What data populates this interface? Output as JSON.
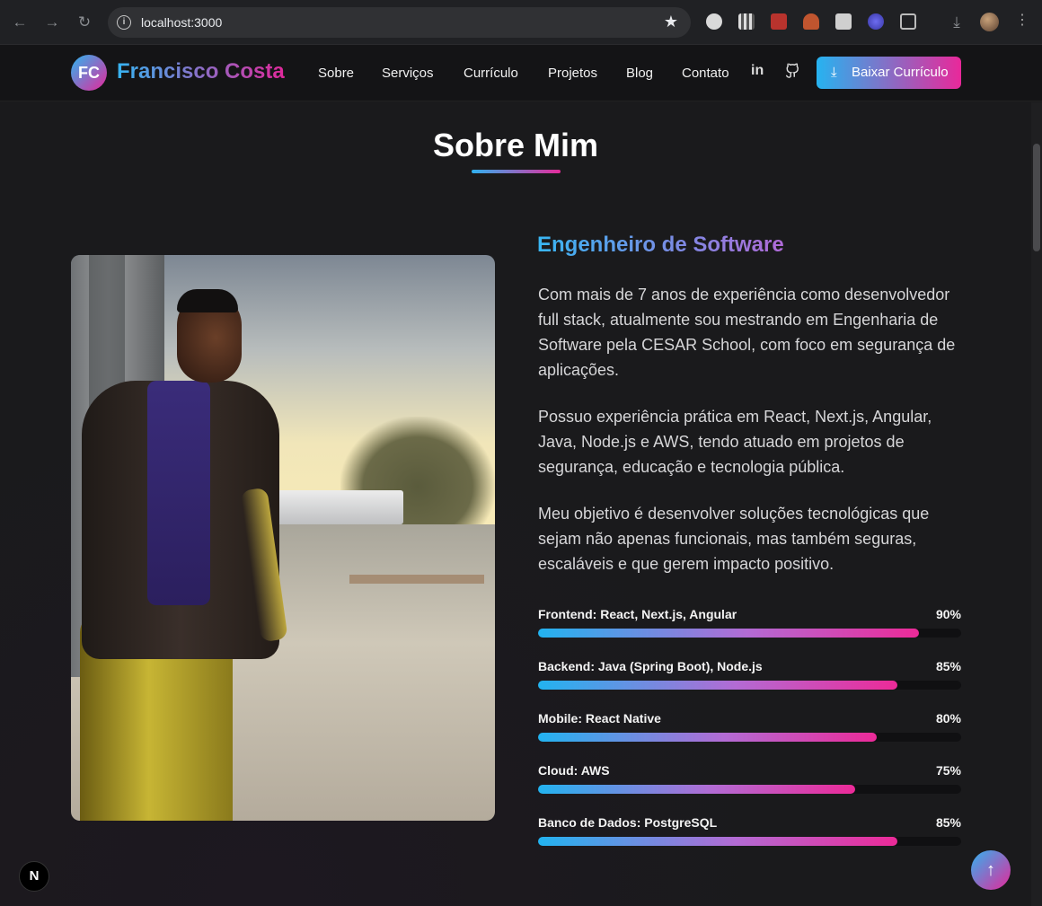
{
  "browser": {
    "url": "localhost:3000",
    "back_icon": "arrow-left-icon",
    "forward_icon": "arrow-right-icon",
    "reload_icon": "reload-icon"
  },
  "header": {
    "logo_initials": "FC",
    "logo_name": "Francisco Costa",
    "nav": [
      "Sobre",
      "Serviços",
      "Currículo",
      "Projetos",
      "Blog",
      "Contato"
    ],
    "cv_button": "Baixar Currículo",
    "colors": {
      "gradient_start": "#26b3f0",
      "gradient_end": "#e9289a"
    }
  },
  "about": {
    "title": "Sobre Mim",
    "subtitle": "Engenheiro de Software",
    "paragraphs": [
      "Com mais de 7 anos de experiência como desenvolvedor full stack, atualmente sou mestrando em Engenharia de Software pela CESAR School, com foco em segurança de aplicações.",
      "Possuo experiência prática em React, Next.js, Angular, Java, Node.js e AWS, tendo atuado em projetos de segurança, educação e tecnologia pública.",
      "Meu objetivo é desenvolver soluções tecnológicas que sejam não apenas funcionais, mas também seguras, escaláveis e que gerem impacto positivo."
    ],
    "skills": [
      {
        "name": "Frontend: React, Next.js, Angular",
        "percent_label": "90%",
        "value": 90
      },
      {
        "name": "Backend: Java (Spring Boot), Node.js",
        "percent_label": "85%",
        "value": 85
      },
      {
        "name": "Mobile: React Native",
        "percent_label": "80%",
        "value": 80
      },
      {
        "name": "Cloud: AWS",
        "percent_label": "75%",
        "value": 75
      },
      {
        "name": "Banco de Dados: PostgreSQL",
        "percent_label": "85%",
        "value": 85
      }
    ]
  },
  "misc": {
    "next_badge": "N",
    "scroll_top_icon": "arrow-up-icon"
  }
}
